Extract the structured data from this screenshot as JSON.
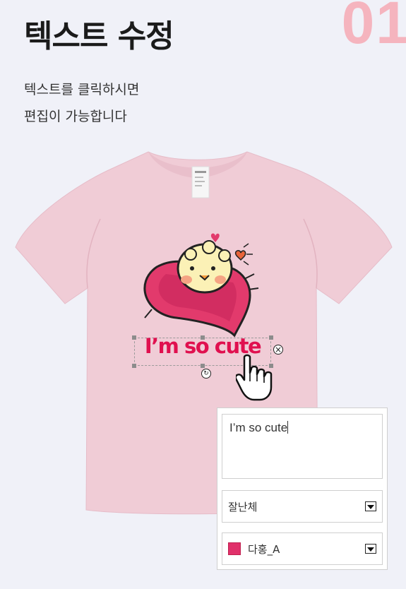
{
  "header": {
    "step_number": "01",
    "title": "텍스트 수정",
    "description_line1": "텍스트를 클릭하시면",
    "description_line2": "편집이 가능합니다"
  },
  "design": {
    "text": "I’m so cute"
  },
  "editor": {
    "text_value": "I’m so cute",
    "font_value": "잘난체",
    "color_value": "다홍_A",
    "color_swatch": "#e0306a"
  },
  "colors": {
    "shirt": "#f0ccd6",
    "accent_number": "#f5b4be",
    "design_text": "#e0104f"
  },
  "icons": [
    "close-circle-icon",
    "rotate-icon",
    "hand-pointer-icon",
    "dropdown-arrow-icon"
  ]
}
